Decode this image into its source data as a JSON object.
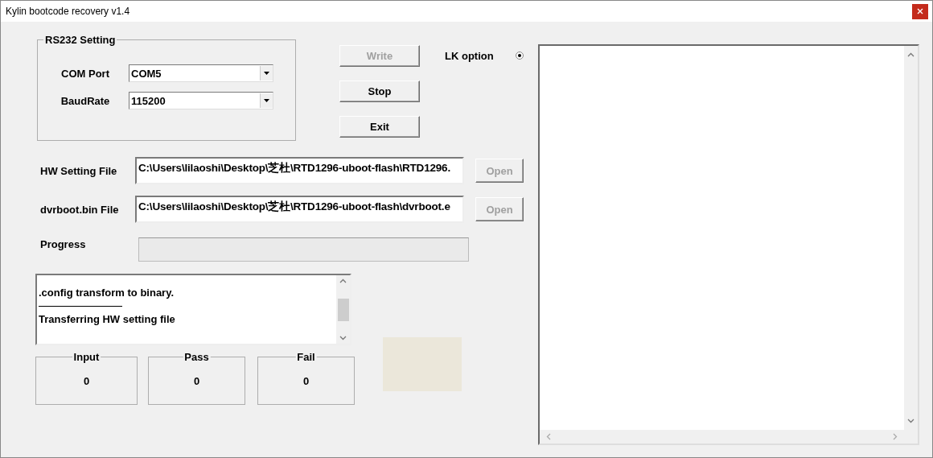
{
  "window": {
    "title": "Kylin bootcode recovery v1.4"
  },
  "rs232": {
    "title": "RS232 Setting",
    "fields": [
      {
        "label": "COM Port",
        "value": "COM5"
      },
      {
        "label": "BaudRate",
        "value": "115200"
      }
    ]
  },
  "buttons": [
    {
      "label": "Write",
      "disabled": true
    },
    {
      "label": "Stop",
      "disabled": false
    },
    {
      "label": "Exit",
      "disabled": false
    }
  ],
  "lk_option": {
    "label": "LK option",
    "selected": true
  },
  "files": [
    {
      "label": "HW Setting File",
      "value": "C:\\Users\\lilaoshi\\Desktop\\芝杜\\RTD1296-uboot-flash\\RTD1296.",
      "button": {
        "label": "Open",
        "disabled": true
      }
    },
    {
      "label": "dvrboot.bin File",
      "value": "C:\\Users\\lilaoshi\\Desktop\\芝杜\\RTD1296-uboot-flash\\dvrboot.e",
      "button": {
        "label": "Open",
        "disabled": true
      }
    }
  ],
  "progress": {
    "label": "Progress",
    "level": 0
  },
  "log": {
    "lines": [
      ".config transform to binary.",
      "Transferring HW setting file"
    ]
  },
  "counters": [
    {
      "label": "Input",
      "value": "0"
    },
    {
      "label": "Pass",
      "value": "0"
    },
    {
      "label": "Fail",
      "value": "0"
    }
  ]
}
